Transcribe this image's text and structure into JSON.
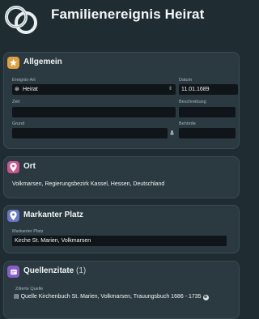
{
  "header": {
    "title": "Familienereignis Heirat"
  },
  "sections": {
    "general": {
      "title": "Allgemein",
      "event_type_label": "Ereignis-Art",
      "event_type_value": "Heirat",
      "date_label": "Datum",
      "date_value": "11.01.1689",
      "time_label": "Zeit",
      "description_label": "Beschreibung",
      "reason_label": "Grund",
      "authority_label": "Behörde"
    },
    "place": {
      "title": "Ort",
      "value": "Volkmarsen, Regierungsbezirk Kassel, Hessen, Deutschland"
    },
    "landmark": {
      "title": "Markanter Platz",
      "field_label": "Markanter Platz",
      "field_value": "Kirche St. Marien, Volkmarsen"
    },
    "citations": {
      "title": "Quellenzitate",
      "count": "(1)",
      "cited_source_label": "Zitierte Quelle",
      "cited_source_value": "Quelle Kirchenbuch St. Marien, Volkmarsen, Trauungsbuch 1686 - 1735"
    }
  },
  "icons": {
    "general": "star-icon",
    "place": "map-pin-icon",
    "landmark": "landmark-pin-icon",
    "citations": "citation-icon"
  },
  "colors": {
    "background": "#1f2d32",
    "card": "#2a3a40",
    "field": "#0f1518",
    "star_accent": "#e0a040",
    "place_accent": "#c9558a",
    "landmark_accent": "#6a77c4",
    "citation_accent": "#8a5cc8"
  }
}
